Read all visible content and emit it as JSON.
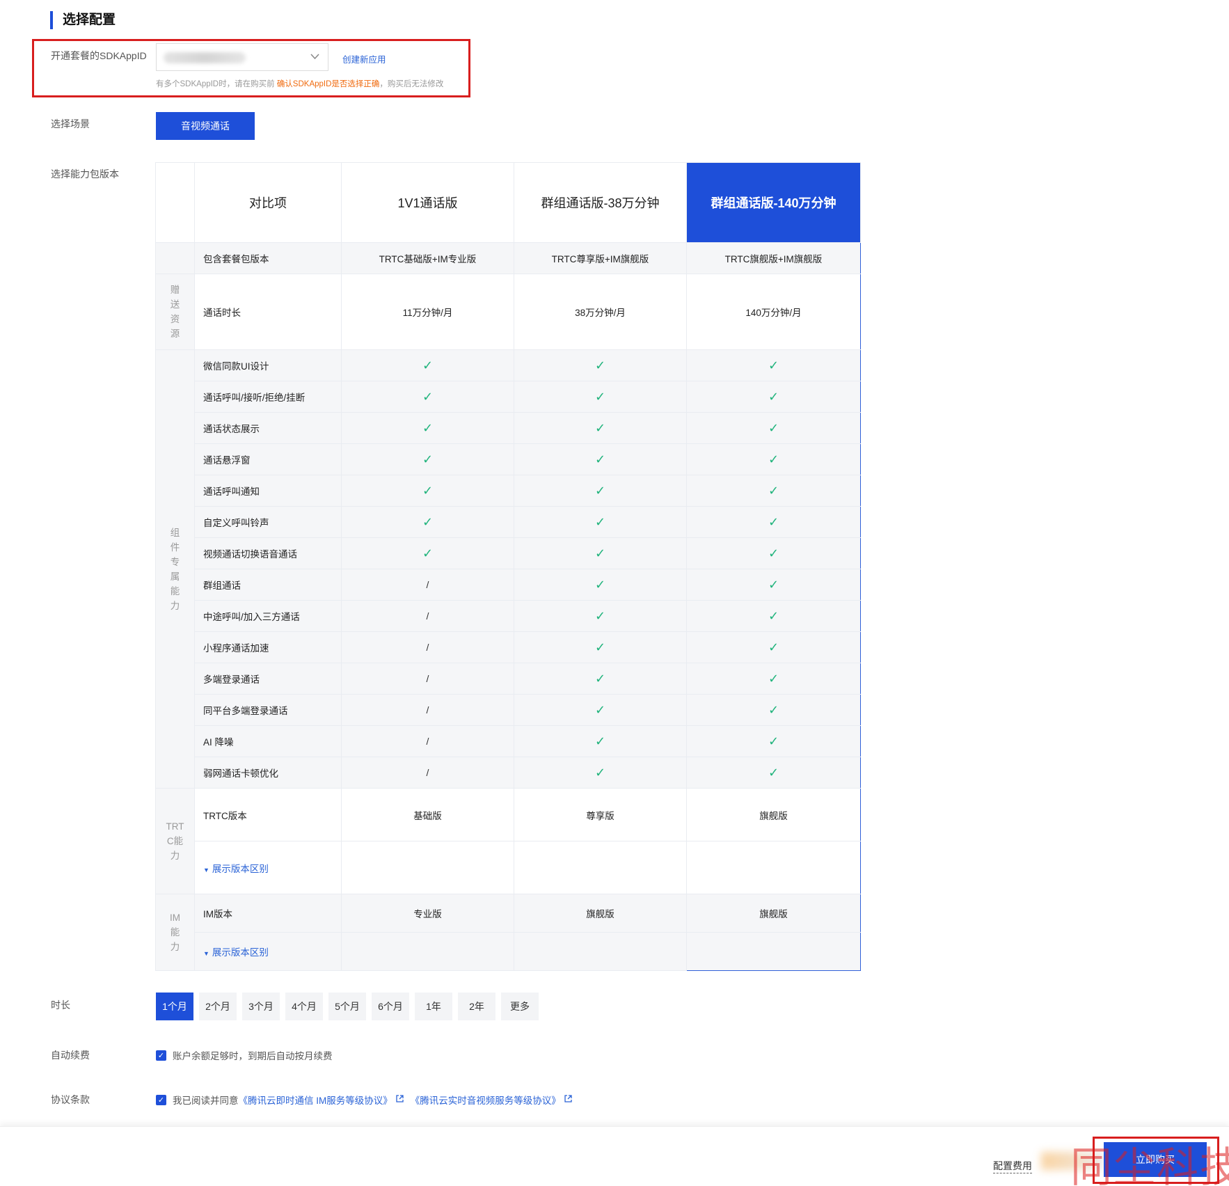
{
  "section_title": "选择配置",
  "appid": {
    "label": "开通套餐的SDKAppID",
    "create_link": "创建新应用",
    "hint_prefix": "有多个SDKAppID时，请在购买前",
    "hint_warning": "确认SDKAppID是否选择正确",
    "hint_suffix": "，购买后无法修改"
  },
  "scene": {
    "label": "选择场景",
    "selected": "音视频通话"
  },
  "package": {
    "label": "选择能力包版本",
    "header": [
      "对比项",
      "1V1通话版",
      "群组通话版-38万分钟",
      "群组通话版-140万分钟"
    ],
    "included_label": "包含套餐包版本",
    "included": [
      "TRTC基础版+IM专业版",
      "TRTC尊享版+IM旗舰版",
      "TRTC旗舰版+IM旗舰版"
    ],
    "gift_category": "赠送资源",
    "duration_label": "通话时长",
    "duration_values": [
      "11万分钟/月",
      "38万分钟/月",
      "140万分钟/月"
    ],
    "component_category": "组件专属能力",
    "features": [
      {
        "name": "微信同款UI设计",
        "v": [
          "✓",
          "✓",
          "✓"
        ]
      },
      {
        "name": "通话呼叫/接听/拒绝/挂断",
        "v": [
          "✓",
          "✓",
          "✓"
        ]
      },
      {
        "name": "通话状态展示",
        "v": [
          "✓",
          "✓",
          "✓"
        ]
      },
      {
        "name": "通话悬浮窗",
        "v": [
          "✓",
          "✓",
          "✓"
        ]
      },
      {
        "name": "通话呼叫通知",
        "v": [
          "✓",
          "✓",
          "✓"
        ]
      },
      {
        "name": "自定义呼叫铃声",
        "v": [
          "✓",
          "✓",
          "✓"
        ]
      },
      {
        "name": "视频通话切换语音通话",
        "v": [
          "✓",
          "✓",
          "✓"
        ]
      },
      {
        "name": "群组通话",
        "v": [
          "/",
          "✓",
          "✓"
        ]
      },
      {
        "name": "中途呼叫/加入三方通话",
        "v": [
          "/",
          "✓",
          "✓"
        ]
      },
      {
        "name": "小程序通话加速",
        "v": [
          "/",
          "✓",
          "✓"
        ]
      },
      {
        "name": "多端登录通话",
        "v": [
          "/",
          "✓",
          "✓"
        ]
      },
      {
        "name": "同平台多端登录通话",
        "v": [
          "/",
          "✓",
          "✓"
        ]
      },
      {
        "name": "AI 降噪",
        "v": [
          "/",
          "✓",
          "✓"
        ]
      },
      {
        "name": "弱网通话卡顿优化",
        "v": [
          "/",
          "✓",
          "✓"
        ]
      }
    ],
    "trtc_category": "TRTC能力",
    "trtc_version_label": "TRTC版本",
    "trtc_versions": [
      "基础版",
      "尊享版",
      "旗舰版"
    ],
    "im_category": "IM能力",
    "im_version_label": "IM版本",
    "im_versions": [
      "专业版",
      "旗舰版",
      "旗舰版"
    ],
    "expand_label": "展示版本区别"
  },
  "duration": {
    "label": "时长",
    "options": [
      "1个月",
      "2个月",
      "3个月",
      "4个月",
      "5个月",
      "6个月",
      "1年",
      "2年",
      "更多"
    ],
    "selected": "1个月"
  },
  "auto_renew": {
    "label": "自动续费",
    "text": "账户余额足够时，到期后自动按月续费"
  },
  "agreement": {
    "label": "协议条款",
    "prefix": "我已阅读并同意",
    "link1": "《腾讯云即时通信 IM服务等级协议》",
    "link2": "《腾讯云实时音视频服务等级协议》"
  },
  "footer": {
    "cost_label": "配置费用",
    "buy_label": "立即购买",
    "watermark": "同尘科技"
  },
  "colors": {
    "primary": "#1e4fd9",
    "check": "#1fb37b",
    "warning": "#f06a0e",
    "highlight_border": "#d81e1e"
  }
}
